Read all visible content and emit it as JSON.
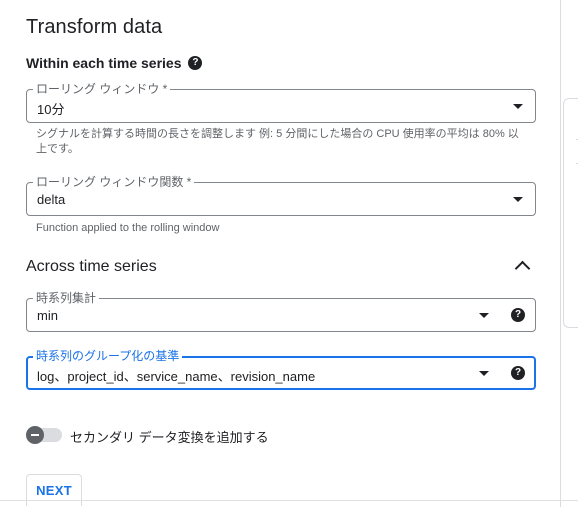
{
  "panel": {
    "title": "Transform data",
    "within": {
      "heading": "Within each time series",
      "rolling_window": {
        "label": "ローリング ウィンドウ *",
        "value": "10分",
        "hint": "シグナルを計算する時間の長さを調整します 例: 5 分間にした場合の CPU 使用率の平均は 80% 以上です。"
      },
      "rolling_window_function": {
        "label": "ローリング ウィンドウ関数 *",
        "value": "delta",
        "hint": "Function applied to the rolling window"
      }
    },
    "across": {
      "heading": "Across time series",
      "aggregation": {
        "label": "時系列集計",
        "value": "min"
      },
      "group_by": {
        "label": "時系列のグループ化の基準",
        "value": "log、project_id、service_name、revision_name"
      }
    },
    "toggle": {
      "label": "セカンダリ データ変換を追加する",
      "state": "off"
    },
    "next_button": "NEXT"
  },
  "icons": {
    "help": "help-icon",
    "dropdown": "arrow-drop-down-icon",
    "collapse": "chevron-up-icon"
  },
  "colors": {
    "accent": "#1a73e8",
    "text": "#202124",
    "secondary_text": "#5f6368",
    "border": "#80868b"
  }
}
